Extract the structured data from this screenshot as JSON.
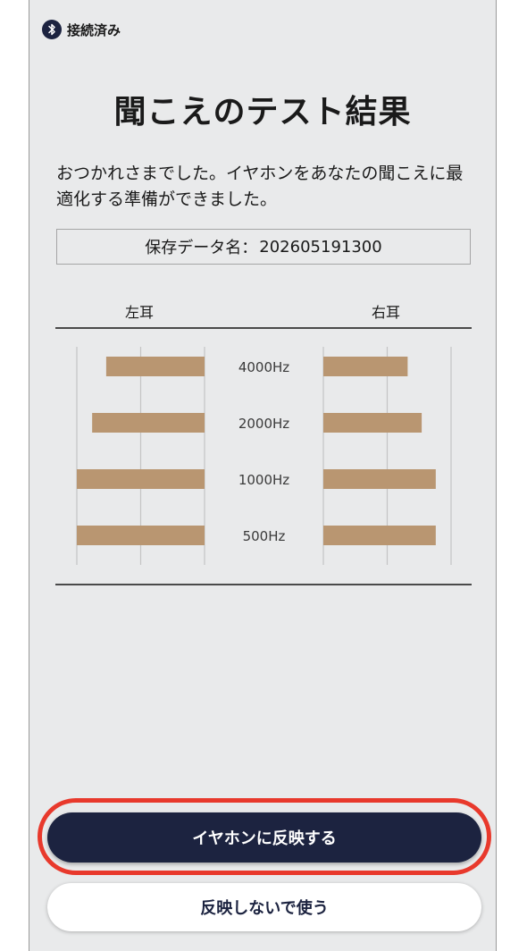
{
  "status": {
    "icon": "bluetooth-icon",
    "text": "接続済み"
  },
  "page": {
    "title": "聞こえのテスト結果",
    "description": "おつかれさまでした。イヤホンをあなたの聞こえに最適化する準備ができました。",
    "save_label": "保存データ名：",
    "save_value": "202605191300"
  },
  "colors": {
    "bar": "#b99671",
    "primary": "#1c2340",
    "highlight": "#e8392c",
    "grid": "#c4c4c4"
  },
  "chart_data": {
    "type": "bar",
    "left_label": "左耳",
    "right_label": "右耳",
    "categories": [
      "4000Hz",
      "2000Hz",
      "1000Hz",
      "500Hz"
    ],
    "series": [
      {
        "name": "左耳",
        "values": [
          0.77,
          0.88,
          1.0,
          1.0
        ]
      },
      {
        "name": "右耳",
        "values": [
          0.66,
          0.77,
          0.88,
          0.88
        ]
      }
    ],
    "ylim": [
      0,
      1
    ]
  },
  "buttons": {
    "apply": "イヤホンに反映する",
    "skip": "反映しないで使う"
  }
}
